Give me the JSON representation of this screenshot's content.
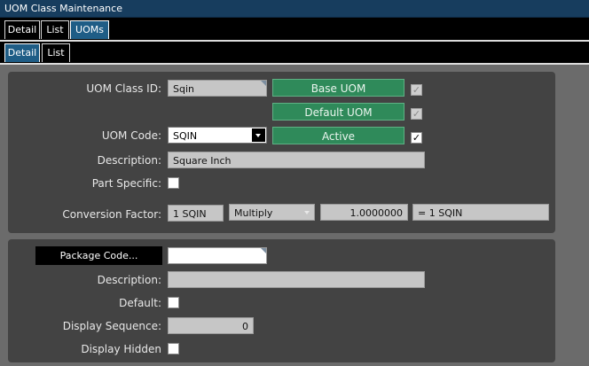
{
  "window": {
    "title": "UOM Class Maintenance"
  },
  "top_tabs": [
    {
      "label": "Detail",
      "active": false
    },
    {
      "label": "List",
      "active": false
    },
    {
      "label": "UOMs",
      "active": true
    }
  ],
  "sub_tabs": [
    {
      "label": "Detail",
      "active": true
    },
    {
      "label": "List",
      "active": false
    }
  ],
  "uom_form": {
    "class_id_label": "UOM Class ID:",
    "class_id_value": "Sqin",
    "base_uom_label": "Base UOM",
    "default_uom_label": "Default UOM",
    "uom_code_label": "UOM Code:",
    "uom_code_value": "SQIN",
    "active_label": "Active",
    "description_label": "Description:",
    "description_value": "Square Inch",
    "part_specific_label": "Part Specific:",
    "conversion_label": "Conversion Factor:",
    "conversion_from": "1 SQIN",
    "conversion_op": "Multiply",
    "conversion_value": "1.0000000",
    "conversion_result": "= 1 SQIN"
  },
  "package_form": {
    "package_code_button": "Package Code...",
    "package_code_value": "",
    "description_label": "Description:",
    "description_value": "",
    "default_label": "Default:",
    "display_sequence_label": "Display Sequence:",
    "display_sequence_value": "0",
    "display_hidden_label": "Display Hidden"
  },
  "checkboxes": {
    "base_uom": true,
    "default_uom": true,
    "active": true,
    "part_specific": false,
    "default": false,
    "display_hidden": false
  },
  "colors": {
    "title_bar": "#173d5e",
    "active_tab": "#1f5d86",
    "green_button": "#2f8a5a",
    "panel": "#434343",
    "background": "#6b6b6b"
  }
}
